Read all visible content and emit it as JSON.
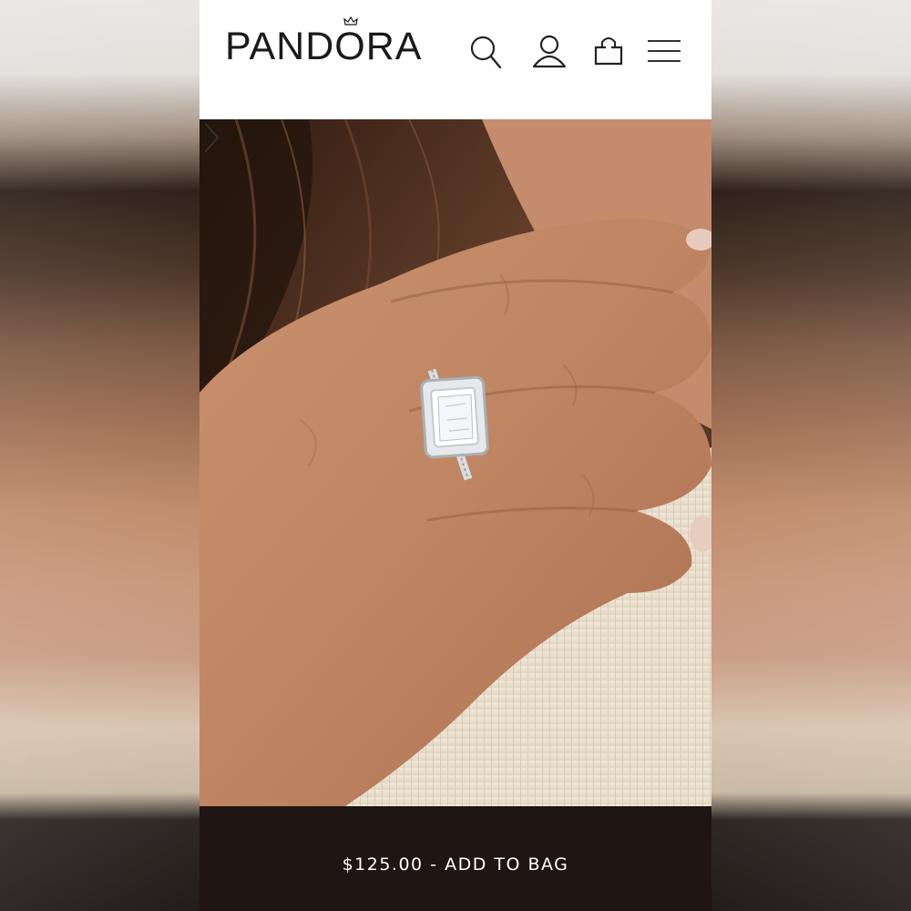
{
  "header": {
    "brand": "PANDORA",
    "icons": [
      "search-icon",
      "account-icon",
      "shopping-bag-icon",
      "hamburger-menu-icon"
    ]
  },
  "hero": {
    "image": "woman-hand-wearing-square-halo-ring",
    "next_icon": "chevron-right-icon"
  },
  "cta": {
    "price": "$125.00",
    "separator": " - ",
    "action": "ADD TO BAG",
    "label": "$125.00 - ADD TO BAG"
  },
  "colors": {
    "cta_background": "#1f1512",
    "cta_text": "#ffffff",
    "header_background": "#ffffff",
    "brand_text": "#1a1a1a"
  }
}
